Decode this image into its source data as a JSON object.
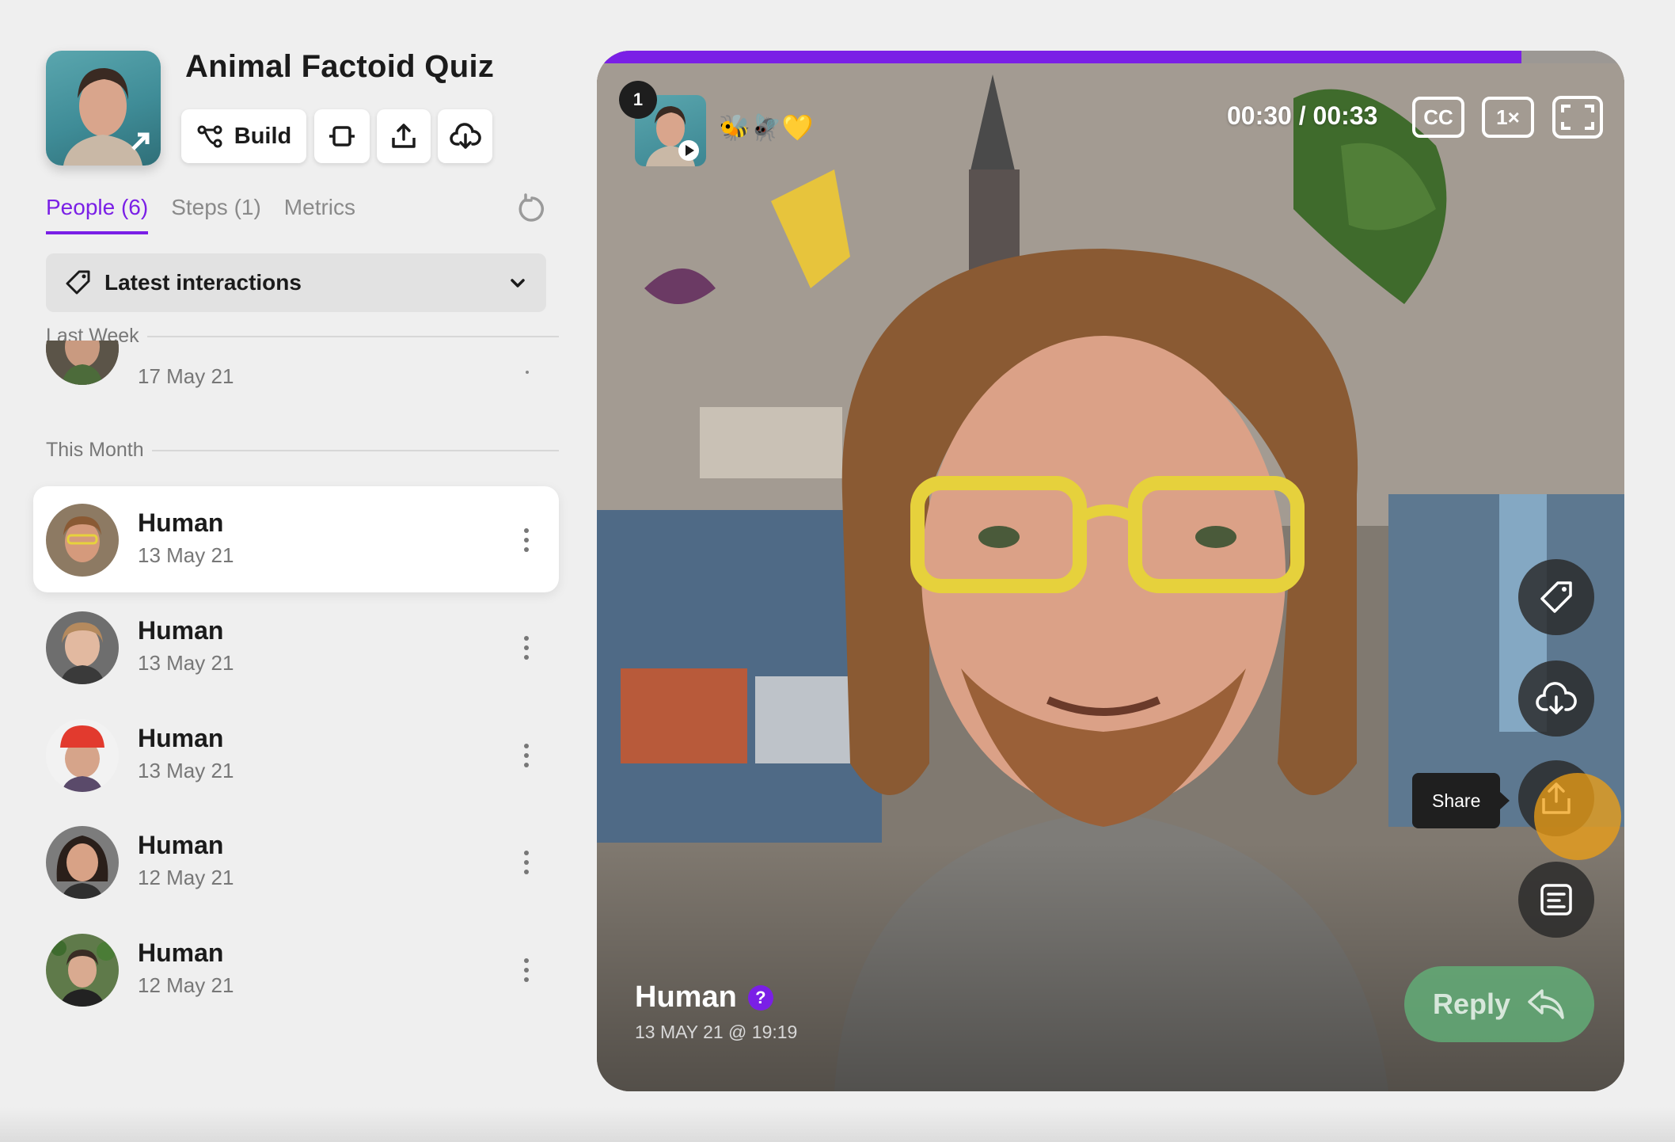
{
  "header": {
    "title": "Animal Factoid Quiz",
    "build_label": "Build"
  },
  "tabs": [
    {
      "label": "People (6)",
      "active": true
    },
    {
      "label": "Steps (1)",
      "active": false
    },
    {
      "label": "Metrics",
      "active": false
    }
  ],
  "filter": {
    "label": "Latest interactions"
  },
  "sections": {
    "last_week": "Last Week",
    "this_month": "This Month"
  },
  "partial_item": {
    "date": "17 May 21"
  },
  "people": [
    {
      "name": "Human",
      "date": "13 May 21",
      "selected": true
    },
    {
      "name": "Human",
      "date": "13 May 21",
      "selected": false
    },
    {
      "name": "Human",
      "date": "13 May 21",
      "selected": false
    },
    {
      "name": "Human",
      "date": "12 May 21",
      "selected": false
    },
    {
      "name": "Human",
      "date": "12 May 21",
      "selected": false
    }
  ],
  "player": {
    "step_number": "1",
    "emojis": "🐝🪰💛",
    "time": "00:30 / 00:33",
    "cc_label": "CC",
    "speed_label": "1×",
    "progress": 0.9,
    "person_name": "Human",
    "badge": "?",
    "timestamp": "13 MAY 21 @ 19:19",
    "share_tooltip": "Share",
    "reply_label": "Reply"
  },
  "colors": {
    "accent": "#7a1fe6",
    "reply": "#62af78",
    "cursor": "#f0a014"
  }
}
